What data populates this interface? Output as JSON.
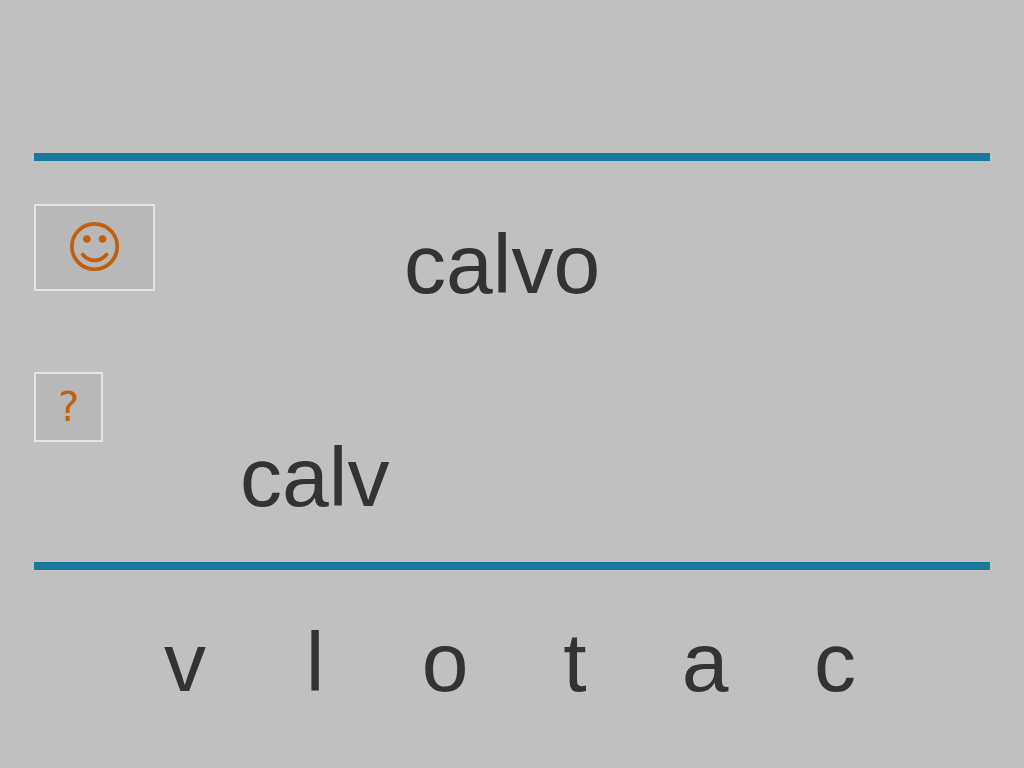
{
  "target_word": "calvo",
  "hint_buttons": [
    {
      "kind": "smiley",
      "label": "☺"
    },
    {
      "kind": "question",
      "label": "?"
    }
  ],
  "answer": "calv",
  "letters": [
    "v",
    "l",
    "o",
    "t",
    "a",
    "c"
  ]
}
